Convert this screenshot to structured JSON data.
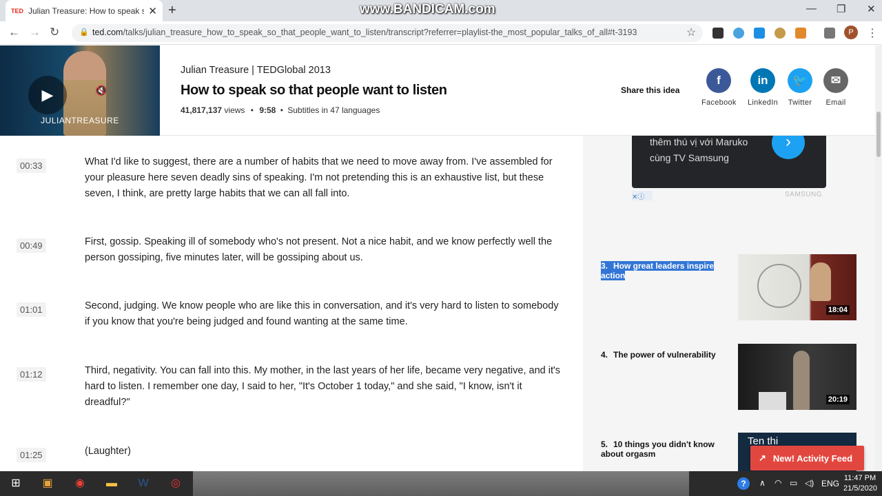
{
  "browser": {
    "tab_favicon": "TED",
    "tab_title": "Julian Treasure: How to speak so that people want to listen",
    "tab_close": "✕",
    "new_tab": "+",
    "watermark": "www.BANDICAM.com",
    "window_controls": [
      "—",
      "❐",
      "✕"
    ],
    "url_host": "ted.com",
    "url_path": "/talks/julian_treasure_how_to_speak_so_that_people_want_to_listen/transcript?referrer=playlist-the_most_popular_talks_of_all#t-3193",
    "profile_initial": "P",
    "extension_icons": [
      "document-icon",
      "target-icon",
      "droplet-icon",
      "cookie-icon",
      "puzzle-icon",
      "media-icon"
    ]
  },
  "talk": {
    "video_label": "JULIANTREASURE",
    "speaker_event": "Julian Treasure | TEDGlobal 2013",
    "title": "How to speak so that people want to listen",
    "views": "41,817,137",
    "views_label": "views",
    "duration": "9:58",
    "subtitles": "Subtitles in 47 languages"
  },
  "share": {
    "label": "Share this idea",
    "buttons": [
      {
        "name": "Facebook",
        "glyph": "f",
        "color": "#3b5998"
      },
      {
        "name": "LinkedIn",
        "glyph": "in",
        "color": "#0077b5"
      },
      {
        "name": "Twitter",
        "glyph": "🐦",
        "color": "#1da1f2"
      },
      {
        "name": "Email",
        "glyph": "✉",
        "color": "#666666"
      }
    ]
  },
  "transcript": [
    {
      "time": "00:33",
      "text": "What I'd like to suggest, there are a number of habits that we need to move away from. I've assembled for your pleasure here seven deadly sins of speaking. I'm not pretending this is an exhaustive list, but these seven, I think, are pretty large habits that we can all fall into."
    },
    {
      "time": "00:49",
      "text": "First, gossip. Speaking ill of somebody who's not present. Not a nice habit, and we know perfectly well the person gossiping, five minutes later, will be gossiping about us."
    },
    {
      "time": "01:01",
      "text": "Second, judging. We know people who are like this in conversation, and it's very hard to listen to somebody if you know that you're being judged and found wanting at the same time."
    },
    {
      "time": "01:12",
      "text": "Third, negativity. You can fall into this. My mother, in the last years of her life, became very negative, and it's hard to listen. I remember one day, I said to her, \"It's October 1 today,\" and she said, \"I know, isn't it dreadful?\""
    },
    {
      "time": "01:25",
      "text": "(Laughter)"
    }
  ],
  "ad": {
    "line1": "thêm thú vị với Maruko",
    "line2": "cùng TV Samsung",
    "arrow": "›",
    "brand": "SAMSUNG",
    "icons": "✕ⓘ"
  },
  "playlist": [
    {
      "num": "3.",
      "title": "How great leaders inspire action",
      "duration": "18:04",
      "selected": true
    },
    {
      "num": "4.",
      "title": "The power of vulnerability",
      "duration": "20:19",
      "selected": false
    },
    {
      "num": "5.",
      "title": "10 things you didn't know about orgasm",
      "thumb_text": "Ten thi",
      "selected": false
    }
  ],
  "toast": {
    "icon": "↗",
    "label": "New! Activity Feed"
  },
  "taskbar": {
    "language": "ENG",
    "time": "11:47 PM",
    "date": "21/5/2020",
    "help": "?"
  }
}
